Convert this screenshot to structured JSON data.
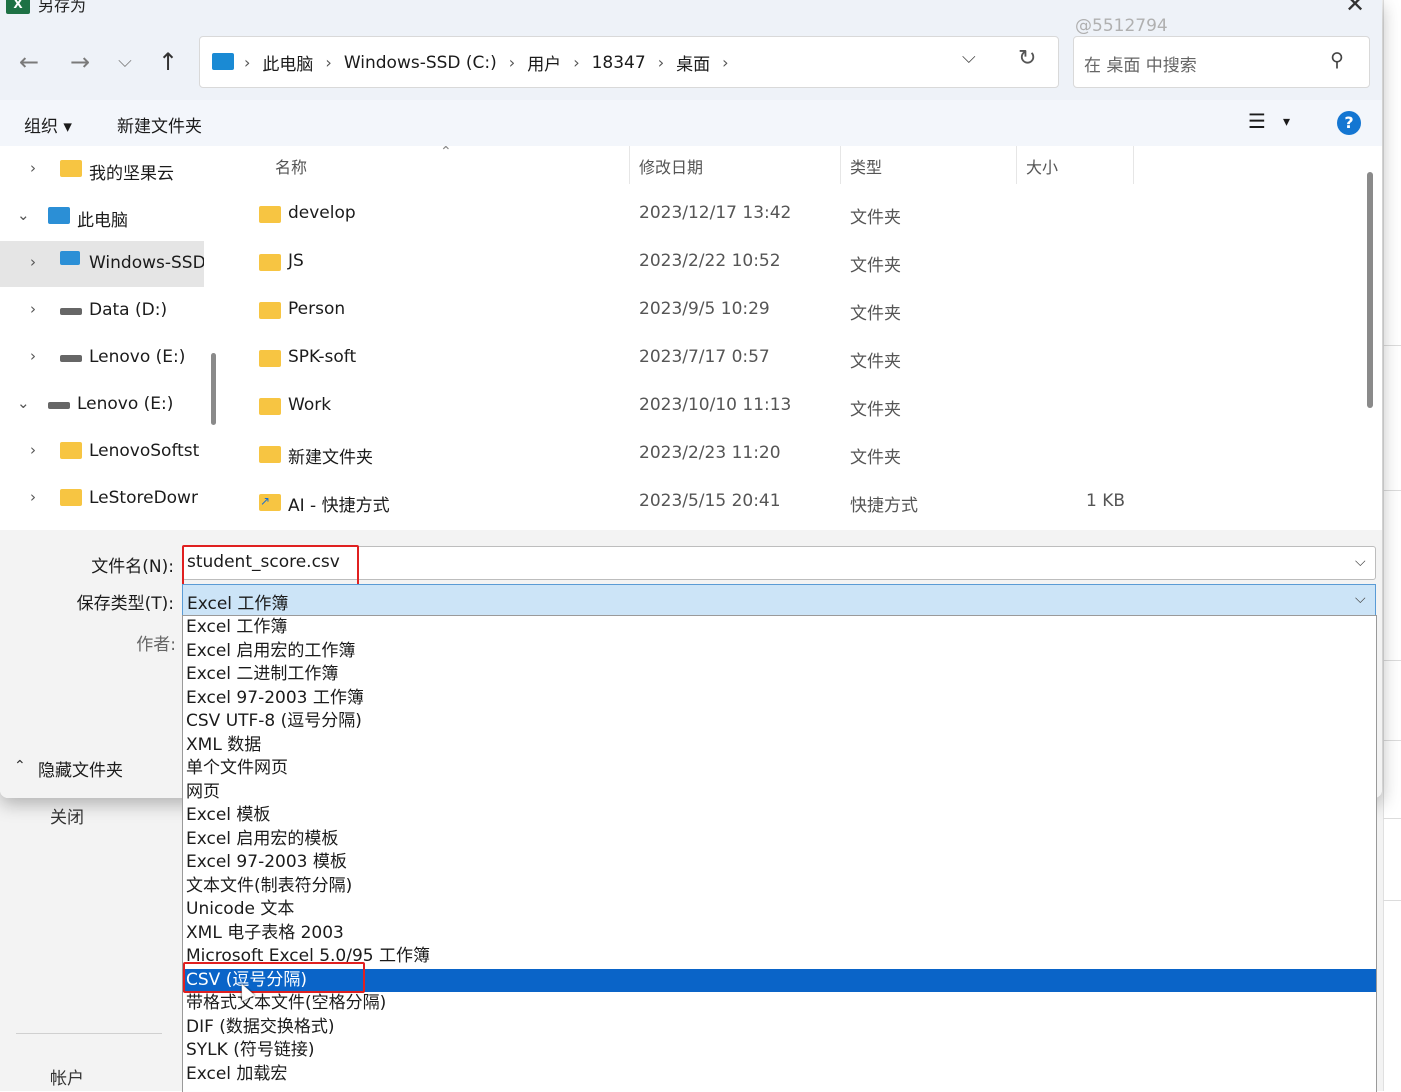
{
  "dialog": {
    "title": "另存为",
    "app_icon": "X",
    "watermark": "@5512794"
  },
  "nav": {
    "back_icon": "←",
    "forward_icon": "→",
    "recent_icon": "⌵",
    "up_icon": "↑",
    "breadcrumbs": [
      "此电脑",
      "Windows-SSD (C:)",
      "用户",
      "18347",
      "桌面"
    ],
    "search_placeholder": "在 桌面 中搜索"
  },
  "toolbar": {
    "organize": "组织 ▾",
    "new_folder": "新建文件夹",
    "view_icon": "☰",
    "view_dropdown": "▾",
    "help": "?"
  },
  "tree": [
    {
      "label": "我的坚果云",
      "icon": "folder-icon",
      "expanded": false,
      "indent": 1
    },
    {
      "label": "此电脑",
      "icon": "pc-icon",
      "expanded": true,
      "indent": 0
    },
    {
      "label": "Windows-SSD",
      "icon": "drive-icon",
      "expanded": false,
      "indent": 1,
      "selected": true
    },
    {
      "label": "Data (D:)",
      "icon": "drive-icon",
      "expanded": false,
      "indent": 1
    },
    {
      "label": "Lenovo (E:)",
      "icon": "drive-icon",
      "expanded": false,
      "indent": 1
    },
    {
      "label": "Lenovo (E:)",
      "icon": "drive-icon",
      "expanded": true,
      "indent": 0
    },
    {
      "label": "LenovoSoftst",
      "icon": "folder-icon",
      "expanded": false,
      "indent": 1
    },
    {
      "label": "LeStoreDowr",
      "icon": "folder-icon",
      "expanded": false,
      "indent": 1
    }
  ],
  "columns": {
    "name": "名称",
    "date": "修改日期",
    "type": "类型",
    "size": "大小"
  },
  "files": [
    {
      "name": "develop",
      "date": "2023/12/17 13:42",
      "type": "文件夹",
      "size": ""
    },
    {
      "name": "JS",
      "date": "2023/2/22 10:52",
      "type": "文件夹",
      "size": ""
    },
    {
      "name": "Person",
      "date": "2023/9/5 10:29",
      "type": "文件夹",
      "size": ""
    },
    {
      "name": "SPK-soft",
      "date": "2023/7/17 0:57",
      "type": "文件夹",
      "size": ""
    },
    {
      "name": "Work",
      "date": "2023/10/10 11:13",
      "type": "文件夹",
      "size": ""
    },
    {
      "name": "新建文件夹",
      "date": "2023/2/23 11:20",
      "type": "文件夹",
      "size": ""
    },
    {
      "name": "AI - 快捷方式",
      "date": "2023/5/15 20:41",
      "type": "快捷方式",
      "size": "1 KB"
    }
  ],
  "form": {
    "filename_label": "文件名(N):",
    "filename_value": "student_score.csv",
    "filetype_label": "保存类型(T):",
    "filetype_value": "Excel 工作簿",
    "author_label": "作者:",
    "hide_folders": "隐藏文件夹"
  },
  "filetype_options": [
    "Excel 工作簿",
    "Excel 启用宏的工作簿",
    "Excel 二进制工作簿",
    "Excel 97-2003 工作簿",
    "CSV UTF-8 (逗号分隔)",
    "XML 数据",
    "单个文件网页",
    "网页",
    "Excel 模板",
    "Excel 启用宏的模板",
    "Excel 97-2003 模板",
    "文本文件(制表符分隔)",
    "Unicode 文本",
    "XML 电子表格 2003",
    "Microsoft Excel 5.0/95 工作簿",
    "CSV (逗号分隔)",
    "带格式文本文件(空格分隔)",
    "DIF (数据交换格式)",
    "SYLK (符号链接)",
    "Excel 加载宏"
  ],
  "selected_option_index": 15,
  "background": {
    "close": "关闭",
    "account": "帐户"
  },
  "colors": {
    "accent": "#0a64c8",
    "highlight_box": "#e02020",
    "filetype_bg": "#cce4f7"
  }
}
